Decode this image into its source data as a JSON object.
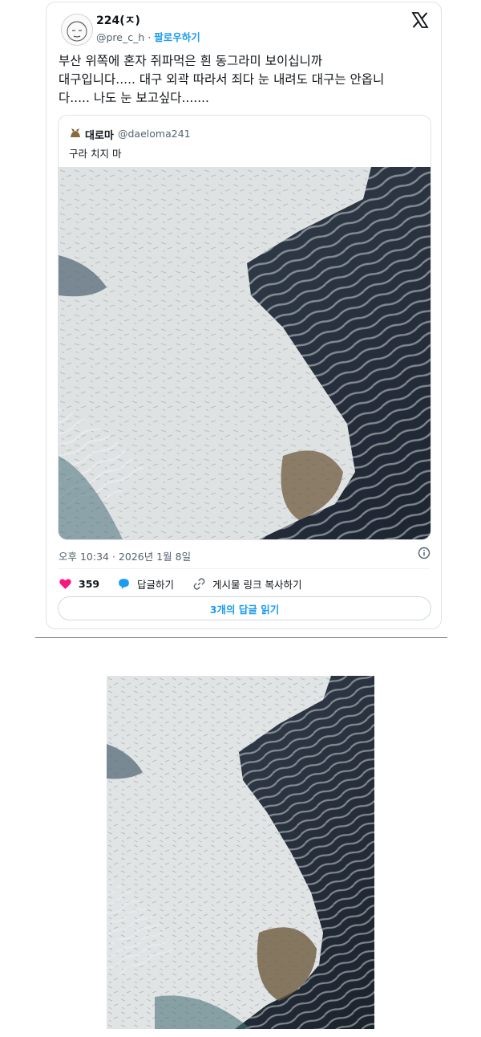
{
  "tweet": {
    "author_name": "224(ㅈ)",
    "author_handle": "@pre_c_h",
    "separator": "·",
    "follow_label": "팔로우하기",
    "text": "부산 위쪽에 혼자 쥐파먹은 흰 동그라미 보이십니까\n대구입니다..... 대구 외곽 따라서 죄다 눈 내려도 대구는 안옵니\n다..... 나도 눈 보고싶다.......",
    "timestamp": "오후 10:34 · 2026년 1월 8일",
    "likes": "359",
    "reply_label": "답글하기",
    "copy_link_label": "게시물 링크 복사하기",
    "read_replies_label": "3개의 답글 읽기"
  },
  "quote": {
    "author_name": "대로마",
    "author_handle": "@daeloma241",
    "text": "구라 치지 마"
  },
  "icons": {
    "logo": "x-logo-icon",
    "info": "info-icon",
    "like": "heart-icon",
    "reply": "speech-bubble-icon",
    "link": "link-icon"
  },
  "colors": {
    "accent": "#1d9bf0",
    "like": "#f91880",
    "muted": "#536471"
  }
}
